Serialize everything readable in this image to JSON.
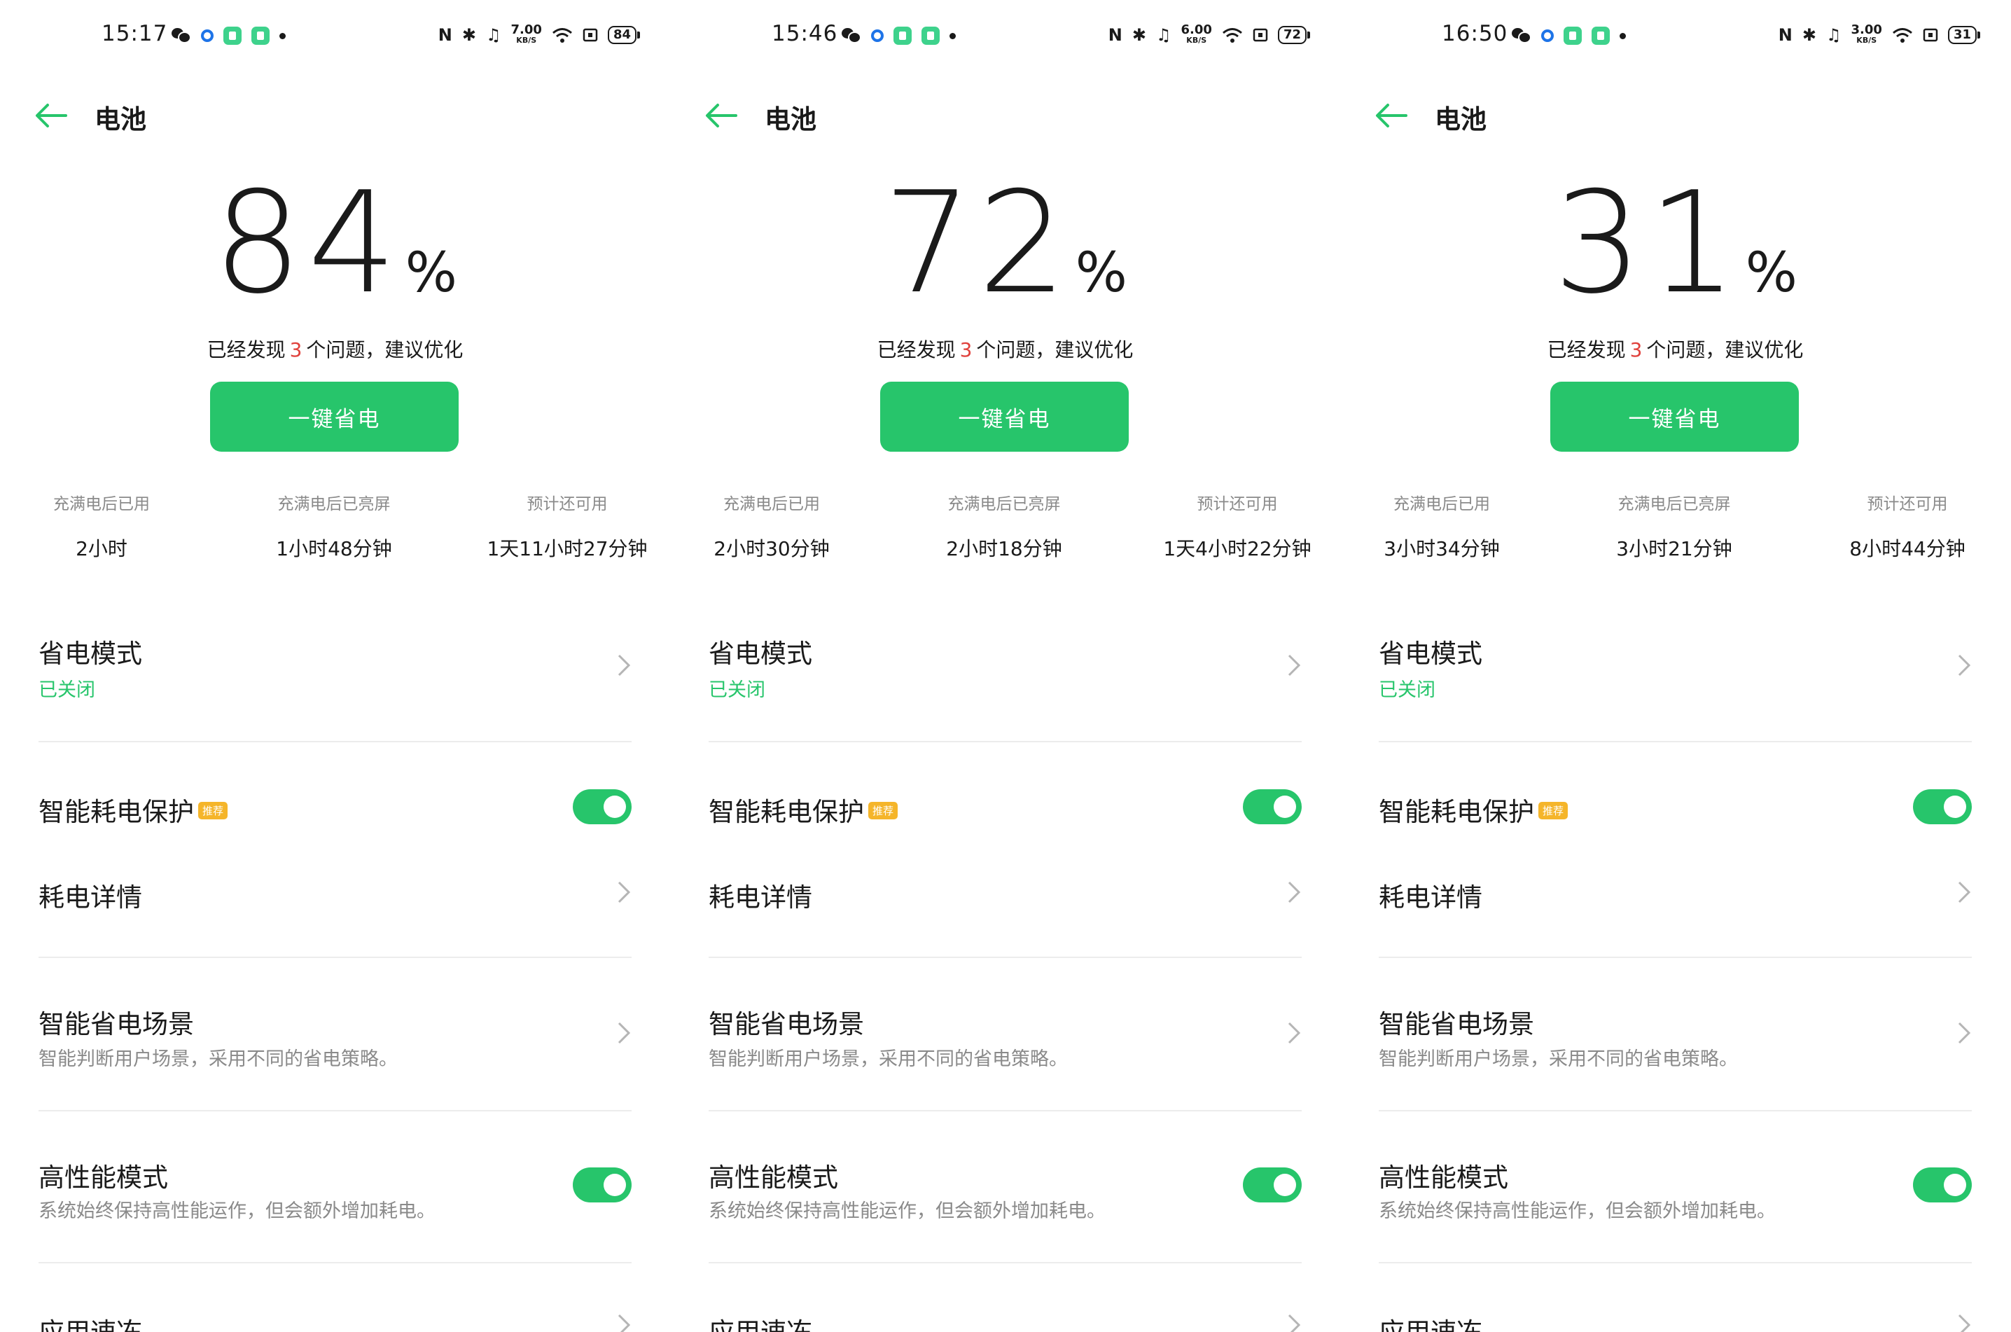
{
  "colors": {
    "accent": "#27c56b",
    "issue_count": "#e0413c",
    "badge": "#f5b52a",
    "muted": "#8a8a8a"
  },
  "panels": [
    {
      "status": {
        "time": "15:17",
        "speed": "7.00",
        "speed_unit": "KB/S",
        "battery": "84"
      },
      "header": {
        "title": "电池"
      },
      "battery": {
        "percent": "84",
        "unit": "%"
      },
      "issues": {
        "prefix": "已经发现",
        "count": "3",
        "suffix": "个问题，建议优化"
      },
      "save_button": "一键省电",
      "stats": [
        {
          "label": "充满电后已用",
          "value": "2小时"
        },
        {
          "label": "充满电后已亮屏",
          "value": "1小时48分钟"
        },
        {
          "label": "预计还可用",
          "value": "1天11小时27分钟"
        }
      ]
    },
    {
      "status": {
        "time": "15:46",
        "speed": "6.00",
        "speed_unit": "KB/S",
        "battery": "72"
      },
      "header": {
        "title": "电池"
      },
      "battery": {
        "percent": "72",
        "unit": "%"
      },
      "issues": {
        "prefix": "已经发现",
        "count": "3",
        "suffix": "个问题，建议优化"
      },
      "save_button": "一键省电",
      "stats": [
        {
          "label": "充满电后已用",
          "value": "2小时30分钟"
        },
        {
          "label": "充满电后已亮屏",
          "value": "2小时18分钟"
        },
        {
          "label": "预计还可用",
          "value": "1天4小时22分钟"
        }
      ]
    },
    {
      "status": {
        "time": "16:50",
        "speed": "3.00",
        "speed_unit": "KB/S",
        "battery": "31"
      },
      "header": {
        "title": "电池"
      },
      "battery": {
        "percent": "31",
        "unit": "%"
      },
      "issues": {
        "prefix": "已经发现",
        "count": "3",
        "suffix": "个问题，建议优化"
      },
      "save_button": "一键省电",
      "stats": [
        {
          "label": "充满电后已用",
          "value": "3小时34分钟"
        },
        {
          "label": "充满电后已亮屏",
          "value": "3小时21分钟"
        },
        {
          "label": "预计还可用",
          "value": "8小时44分钟"
        }
      ]
    }
  ],
  "settings": {
    "power_saving_mode": {
      "title": "省电模式",
      "status": "已关闭"
    },
    "smart_protection": {
      "title": "智能耗电保护",
      "badge": "推荐",
      "enabled": true
    },
    "usage_details": {
      "title": "耗电详情"
    },
    "smart_scenes": {
      "title": "智能省电场景",
      "subtitle": "智能判断用户场景，采用不同的省电策略。"
    },
    "high_performance": {
      "title": "高性能模式",
      "subtitle": "系统始终保持高性能运作，但会额外增加耗电。",
      "enabled": true
    },
    "app_freeze": {
      "title": "应用速冻"
    }
  }
}
